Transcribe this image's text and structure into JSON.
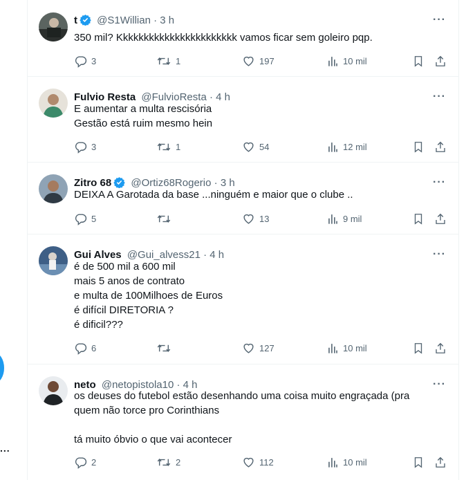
{
  "colors": {
    "accent": "#1d9bf0",
    "text": "#0f1419",
    "muted": "#536471",
    "border": "#eff3f4"
  },
  "icons": {
    "reply": "reply-icon",
    "retweet": "retweet-icon",
    "like": "heart-icon",
    "views": "views-chart-icon",
    "bookmark": "bookmark-icon",
    "share": "share-icon",
    "more": "more-icon",
    "verified": "verified-badge-icon"
  },
  "left_rail": {
    "more_label": "..."
  },
  "tweets": [
    {
      "name": "t",
      "verified": true,
      "handle": "@S1Willian",
      "dot": "·",
      "time": "3 h",
      "more_label": "···",
      "lines": [
        "350 mil? Kkkkkkkkkkkkkkkkkkkkkkk vamos ficar sem goleiro pqp."
      ],
      "replies": "3",
      "retweets": "1",
      "likes": "197",
      "views": "10 mil"
    },
    {
      "name": "Fulvio Resta",
      "verified": false,
      "handle": "@FulvioResta",
      "dot": "·",
      "time": "4 h",
      "more_label": "···",
      "lines": [
        "E aumentar a multa rescisória",
        "Gestão está ruim mesmo hein"
      ],
      "replies": "3",
      "retweets": "1",
      "likes": "54",
      "views": "12 mil"
    },
    {
      "name": "Zitro 68",
      "verified": true,
      "handle": "@Ortiz68Rogerio",
      "dot": "·",
      "time": "3 h",
      "more_label": "···",
      "lines": [
        "DEIXA A Garotada da base ...ninguém e maior que o clube .."
      ],
      "replies": "5",
      "retweets": "",
      "likes": "13",
      "views": "9 mil"
    },
    {
      "name": "Gui Alves",
      "verified": false,
      "handle": "@Gui_alvess21",
      "dot": "·",
      "time": "4 h",
      "more_label": "···",
      "lines": [
        "é de 500 mil a 600 mil",
        "mais 5 anos de contrato",
        "e multa de 100Milhoes de Euros",
        "é difícil DIRETORIA ?",
        "é dificil???"
      ],
      "replies": "6",
      "retweets": "",
      "likes": "127",
      "views": "10 mil"
    },
    {
      "name": "neto",
      "verified": false,
      "handle": "@netopistola10",
      "dot": "·",
      "time": "4 h",
      "more_label": "···",
      "lines": [
        "os deuses do futebol estão desenhando uma coisa muito engraçada (pra",
        "quem não torce pro Corinthians",
        "",
        "tá muito óbvio o que vai acontecer"
      ],
      "replies": "2",
      "retweets": "2",
      "likes": "112",
      "views": "10 mil"
    }
  ]
}
